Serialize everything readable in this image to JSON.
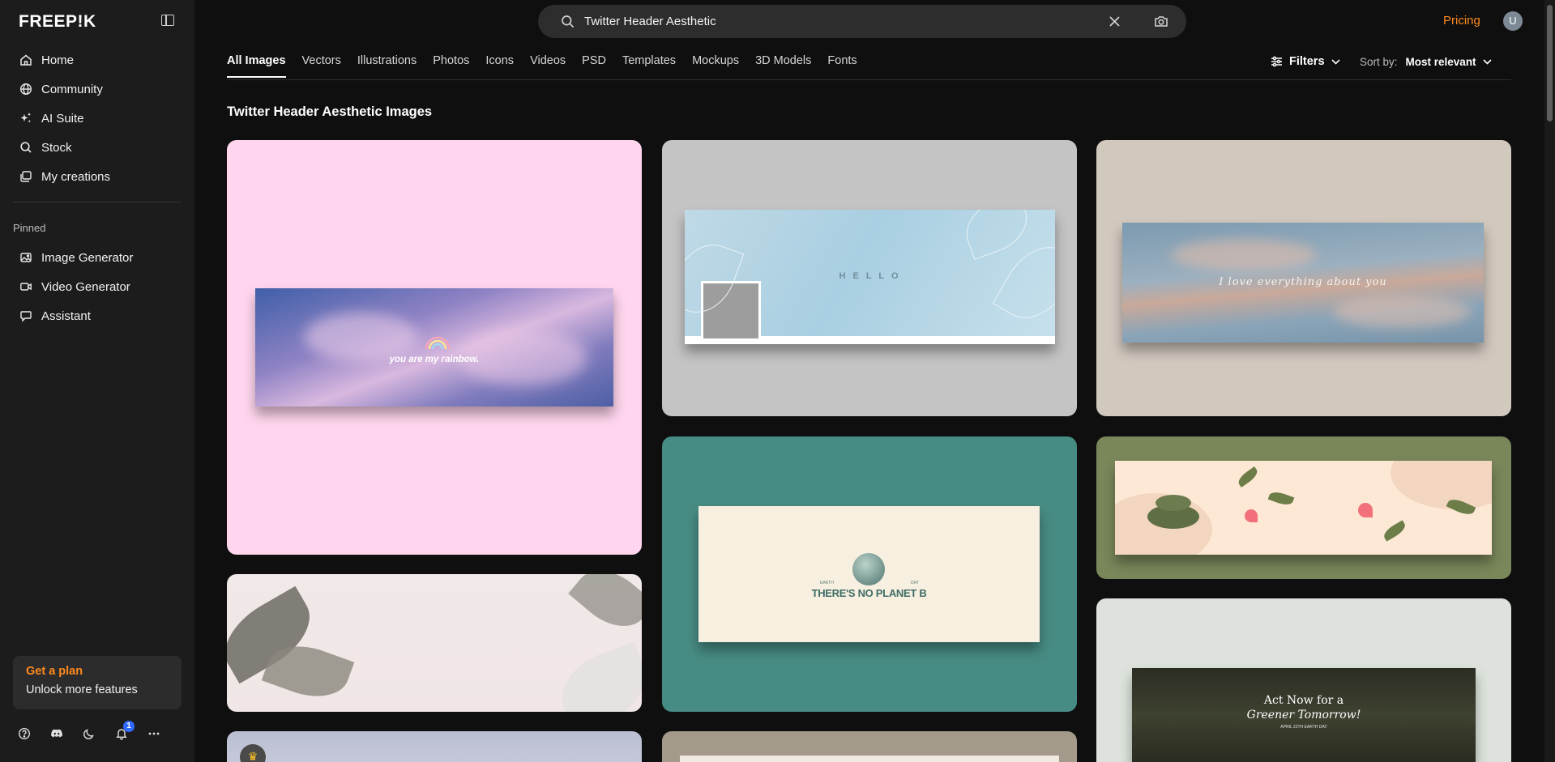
{
  "brand": {
    "logo": "FREEP!K"
  },
  "sidebar": {
    "nav": [
      {
        "label": "Home",
        "icon": "home-icon"
      },
      {
        "label": "Community",
        "icon": "globe-icon"
      },
      {
        "label": "AI Suite",
        "icon": "sparkle-icon"
      },
      {
        "label": "Stock",
        "icon": "search-icon"
      },
      {
        "label": "My creations",
        "icon": "gallery-icon"
      }
    ],
    "pinned_title": "Pinned",
    "pinned": [
      {
        "label": "Image Generator",
        "icon": "image-icon"
      },
      {
        "label": "Video Generator",
        "icon": "video-icon"
      },
      {
        "label": "Assistant",
        "icon": "chat-icon"
      }
    ],
    "plan": {
      "title": "Get a plan",
      "subtitle": "Unlock more features"
    },
    "notifications_count": "1"
  },
  "header": {
    "search_value": "Twitter Header Aesthetic",
    "pricing_label": "Pricing",
    "avatar_initial": "U"
  },
  "tabs": [
    "All Images",
    "Vectors",
    "Illustrations",
    "Photos",
    "Icons",
    "Videos",
    "PSD",
    "Templates",
    "Mockups",
    "3D Models",
    "Fonts"
  ],
  "active_tab": "All Images",
  "toolbar": {
    "filters_label": "Filters",
    "sort_label": "Sort by:",
    "sort_value": "Most relevant"
  },
  "results_title": "Twitter Header Aesthetic Images",
  "cards": {
    "rainbow": {
      "text": "you are my rainbow.",
      "bg": "#ffd6ee"
    },
    "hello": {
      "text": "H E L L O",
      "bg": "#c4c4c4"
    },
    "love": {
      "text": "I love everything about you",
      "bg": "#d1c8be"
    },
    "planet": {
      "text": "THERE'S NO PLANET B",
      "left_small": "EARTH",
      "right_small": "DAY",
      "bg": "#478c84"
    },
    "plants": {
      "bg": "#7a875a"
    },
    "greener": {
      "line1": "Act Now for a",
      "line2": "Greener Tomorrow!",
      "line3": "APRIL 22TH EARTH DAY",
      "bg": "#dde3dc"
    }
  }
}
